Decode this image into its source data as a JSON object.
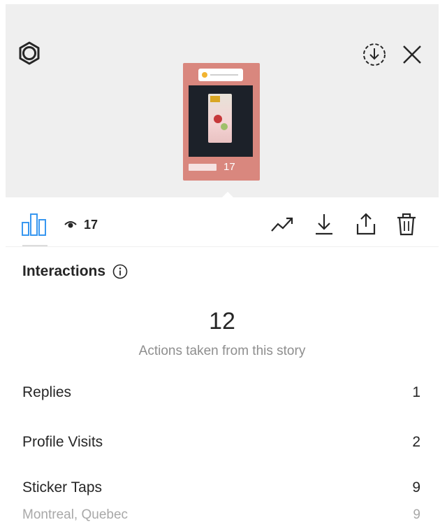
{
  "preview": {
    "view_count": "17"
  },
  "toolbar": {
    "view_count": "17"
  },
  "interactions": {
    "title": "Interactions",
    "total": "12",
    "total_caption": "Actions taken from this story",
    "rows": [
      {
        "label": "Replies",
        "value": "1"
      },
      {
        "label": "Profile Visits",
        "value": "2"
      },
      {
        "label": "Sticker Taps",
        "value": "9"
      },
      {
        "label": "Montreal, Quebec",
        "value": "9"
      }
    ]
  },
  "colors": {
    "accent": "#3897f0",
    "top_bg": "#efefef",
    "thumb_bg": "#d9877e"
  },
  "icons": [
    "settings-icon",
    "save-story-icon",
    "close-icon",
    "insights-icon",
    "eye-icon",
    "boost-icon",
    "download-icon",
    "share-icon",
    "delete-icon",
    "info-icon"
  ]
}
